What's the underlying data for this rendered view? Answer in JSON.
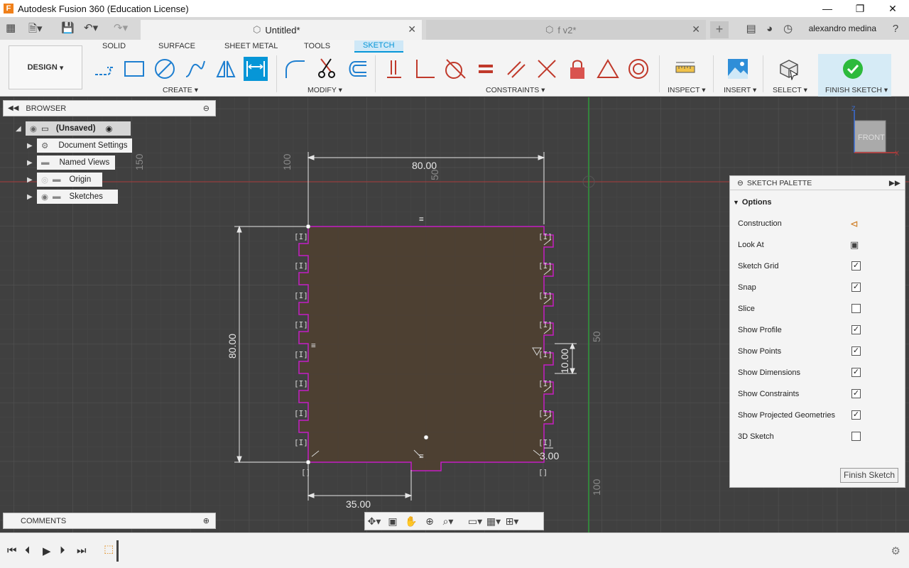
{
  "window": {
    "title": "Autodesk Fusion 360 (Education License)",
    "app_logo": "F",
    "controls": {
      "minimize": "—",
      "maximize": "❐",
      "close": "✕"
    }
  },
  "doc_tabs": [
    {
      "label": "Untitled*",
      "active": true
    },
    {
      "label": "f v2*",
      "active": false
    }
  ],
  "user": {
    "name": "alexandro medina"
  },
  "workspace": {
    "label": "DESIGN"
  },
  "workspace_tabs": [
    "SOLID",
    "SURFACE",
    "SHEET METAL",
    "TOOLS",
    "SKETCH"
  ],
  "tool_groups": {
    "create": "CREATE",
    "modify": "MODIFY",
    "constraints": "CONSTRAINTS",
    "inspect": "INSPECT",
    "insert": "INSERT",
    "select": "SELECT",
    "finish": "FINISH SKETCH"
  },
  "browser": {
    "title": "BROWSER",
    "items": [
      {
        "label": "(Unsaved)"
      },
      {
        "label": "Document Settings"
      },
      {
        "label": "Named Views"
      },
      {
        "label": "Origin"
      },
      {
        "label": "Sketches"
      }
    ]
  },
  "viewcube": {
    "label": "FRONT",
    "axis_z": "Z",
    "axis_x": "X"
  },
  "sketch_palette": {
    "title": "SKETCH PALETTE",
    "section": "Options",
    "options": [
      {
        "label": "Construction",
        "type": "icon",
        "icon": "construction-icon"
      },
      {
        "label": "Look At",
        "type": "icon",
        "icon": "look-at-icon"
      },
      {
        "label": "Sketch Grid",
        "type": "checkbox",
        "checked": true
      },
      {
        "label": "Snap",
        "type": "checkbox",
        "checked": true
      },
      {
        "label": "Slice",
        "type": "checkbox",
        "checked": false
      },
      {
        "label": "Show Profile",
        "type": "checkbox",
        "checked": true
      },
      {
        "label": "Show Points",
        "type": "checkbox",
        "checked": true
      },
      {
        "label": "Show Dimensions",
        "type": "checkbox",
        "checked": true
      },
      {
        "label": "Show Constraints",
        "type": "checkbox",
        "checked": true
      },
      {
        "label": "Show Projected Geometries",
        "type": "checkbox",
        "checked": true
      },
      {
        "label": "3D Sketch",
        "type": "checkbox",
        "checked": false
      }
    ],
    "finish_button": "Finish Sketch"
  },
  "dimensions": {
    "top_width": "80.00",
    "left_height": "80.00",
    "tab_height": "10.00",
    "tab_depth": "3.00",
    "bottom_offset": "35.00"
  },
  "grid_labels": {
    "v150": "150",
    "v100": "100",
    "v50": "50",
    "h50": "50",
    "h100": "100"
  },
  "comments": {
    "title": "COMMENTS"
  },
  "colors": {
    "sketch_line": "#c41ec4",
    "profile_fill": "#4e4031",
    "accent": "#0696d7",
    "finish_green": "#2dba3c"
  }
}
